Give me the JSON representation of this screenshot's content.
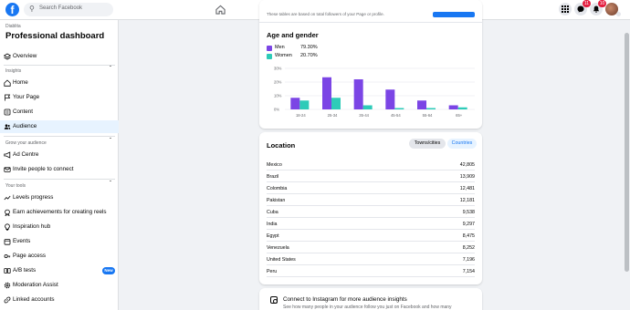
{
  "header": {
    "search_placeholder": "Search Facebook",
    "badges": {
      "messenger": "11",
      "notifications": "10"
    }
  },
  "sidebar": {
    "page_name": "Diablita",
    "title": "Professional dashboard",
    "overview": "Overview",
    "insights_label": "Insights",
    "insights_items": [
      "Home",
      "Your Page",
      "Content",
      "Audience"
    ],
    "grow_label": "Grow your audience",
    "grow_items": [
      "Ad Centre",
      "Invite people to connect"
    ],
    "tools_label": "Your tools",
    "tools_items": [
      "Levels progress",
      "Earn achievements for creating reels",
      "Inspiration hub",
      "Events",
      "Page access",
      "A/B tests",
      "Moderation Assist",
      "Linked accounts"
    ],
    "new_badge": "New"
  },
  "top_card": {
    "cut_text": "These tables are based on total followers of your Page or profile."
  },
  "age_gender": {
    "title": "Age and gender",
    "legend": [
      {
        "name": "Men",
        "pct": "79.30%",
        "color": "#7b45e5"
      },
      {
        "name": "Women",
        "pct": "20.70%",
        "color": "#2ecbb8"
      }
    ],
    "chart_data": {
      "type": "bar",
      "categories": [
        "18-24",
        "25-34",
        "35-44",
        "45-54",
        "55-64",
        "65+"
      ],
      "series": [
        {
          "name": "Men",
          "values": [
            8.5,
            23.5,
            22.0,
            14.5,
            6.5,
            3.0
          ]
        },
        {
          "name": "Women",
          "values": [
            6.5,
            8.5,
            3.0,
            1.0,
            1.0,
            1.5
          ]
        }
      ],
      "yticks": [
        "0%",
        "10%",
        "20%",
        "30%"
      ],
      "ylim": [
        0,
        30
      ]
    }
  },
  "location": {
    "title": "Location",
    "tabs": [
      "Towns/cities",
      "Countries"
    ],
    "rows": [
      {
        "name": "Mexico",
        "value": "42,805"
      },
      {
        "name": "Brazil",
        "value": "13,909"
      },
      {
        "name": "Colombia",
        "value": "12,481"
      },
      {
        "name": "Pakistan",
        "value": "12,181"
      },
      {
        "name": "Cuba",
        "value": "9,538"
      },
      {
        "name": "India",
        "value": "9,297"
      },
      {
        "name": "Egypt",
        "value": "8,475"
      },
      {
        "name": "Venezuela",
        "value": "8,252"
      },
      {
        "name": "United States",
        "value": "7,196"
      },
      {
        "name": "Peru",
        "value": "7,154"
      }
    ]
  },
  "instagram": {
    "title": "Connect to Instagram for more audience insights",
    "subtitle": "See how many people in your audience follow you just on Facebook and how many"
  }
}
